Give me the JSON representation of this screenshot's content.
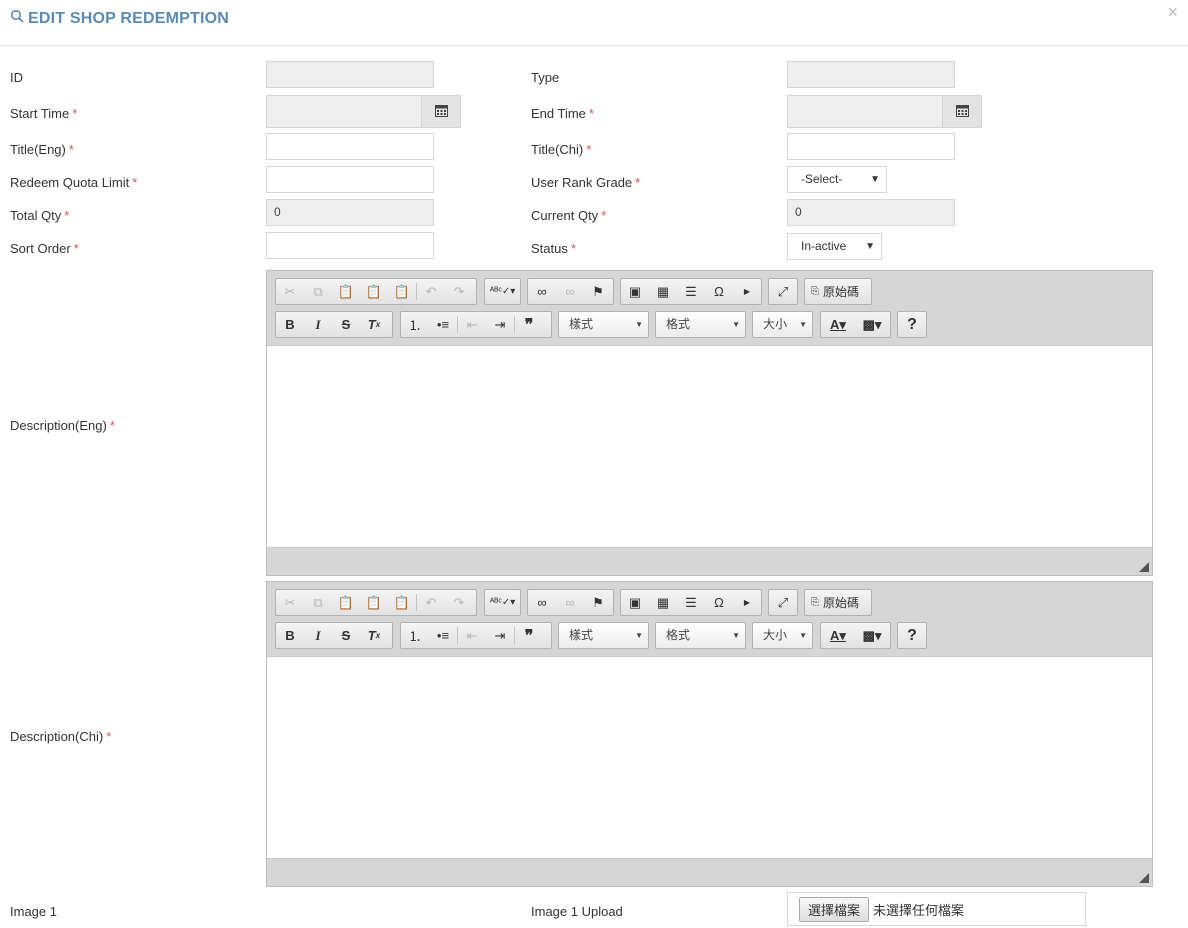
{
  "modal": {
    "title": "EDIT SHOP REDEMPTION",
    "close_symbol": "×"
  },
  "form": {
    "id_label": "ID",
    "id_value": "",
    "type_label": "Type",
    "type_value": "",
    "start_time_label": "Start Time",
    "start_time_value": "",
    "end_time_label": "End Time",
    "end_time_value": "",
    "title_eng_label": "Title(Eng)",
    "title_eng_value": "",
    "title_chi_label": "Title(Chi)",
    "title_chi_value": "",
    "redeem_quota_label": "Redeem Quota Limit",
    "redeem_quota_value": "",
    "user_rank_label": "User Rank Grade",
    "user_rank_selected": "-Select-",
    "total_qty_label": "Total Qty",
    "total_qty_value": "0",
    "current_qty_label": "Current Qty",
    "current_qty_value": "0",
    "sort_order_label": "Sort Order",
    "sort_order_value": "",
    "status_label": "Status",
    "status_selected": "In-active",
    "desc_eng_label": "Description(Eng)",
    "desc_chi_label": "Description(Chi)",
    "image1_label": "Image 1",
    "image1_upload_label": "Image 1 Upload",
    "required_mark": "*"
  },
  "editor": {
    "source_label": "原始碼",
    "styles_label": "樣式",
    "format_label": "格式",
    "size_label": "大小",
    "help_label": "?"
  },
  "file_input": {
    "button_label": "選擇檔案",
    "status_text": "未選擇任何檔案"
  },
  "colors": {
    "title": "#5b8ab5",
    "required": "#d9534f",
    "readonly_bg": "#eeeeee"
  }
}
